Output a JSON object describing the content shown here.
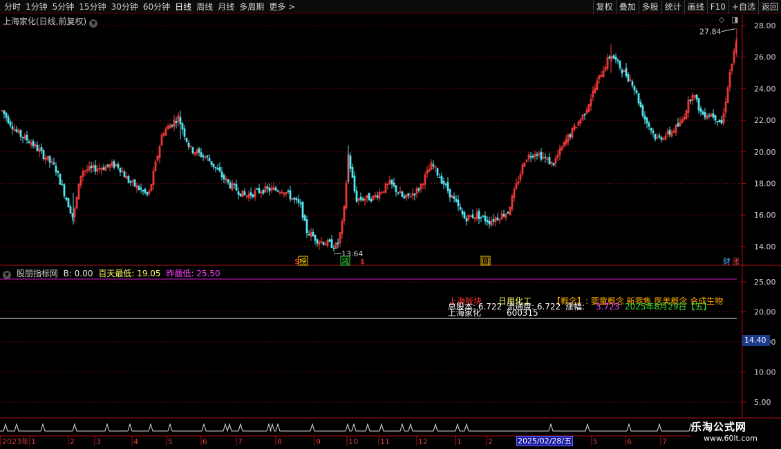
{
  "toolbar": {
    "periods": [
      "分时",
      "1分钟",
      "5分钟",
      "15分钟",
      "30分钟",
      "60分钟",
      "日线",
      "周线",
      "月线",
      "多周期",
      "更多 >"
    ],
    "active_period": "日线",
    "buttons": [
      "复权",
      "叠加",
      "多股",
      "统计",
      "画线",
      "F10",
      "+自选",
      "返回"
    ]
  },
  "main_chart": {
    "title": "上海家化(日线,前复权)",
    "y_ticks": [
      "28.00",
      "26.00",
      "24.00",
      "22.00",
      "20.00",
      "18.00",
      "16.00",
      "14.00"
    ],
    "high_label": "27.84",
    "low_label": "13.64",
    "markers": [
      {
        "text": "$",
        "color": "#ff3030"
      },
      {
        "text": "榜",
        "color": "#ffcc00"
      },
      {
        "text": "减",
        "color": "#33dd33"
      },
      {
        "text": "$",
        "color": "#ff3030"
      },
      {
        "text": "回",
        "color": "#ffcc00"
      },
      {
        "text": "财",
        "color": "#55aaff"
      },
      {
        "text": "涨",
        "color": "#ff4444"
      }
    ]
  },
  "indicator": {
    "name": "股朋指标网",
    "b_text": "B: 0.00",
    "low100_label": "百天最低:",
    "low100_value": "19.05",
    "prevlow_label": "昨最低:",
    "prevlow_value": "25.50",
    "y_ticks": [
      "25.00",
      "20.00",
      "15.00",
      "10.00",
      "5.00"
    ],
    "current_value": "14.40",
    "info": {
      "sector_label": "上海板块",
      "industry": "日用化工",
      "concept": "【概念】: 婴童概念 新零售 医美概念 合成生物",
      "total_shares": "总股本: 6.722",
      "float_shares": "流通盘: 6.722",
      "change_label": "涨幅:",
      "change_value": "3.723",
      "date": "2025年8月29日【五】",
      "stock_name": "上海家化",
      "stock_code": "600315"
    }
  },
  "date_axis": {
    "labels": [
      "2023年",
      "1",
      "2",
      "3",
      "4",
      "5",
      "6",
      "7",
      "8",
      "9",
      "10",
      "11",
      "12",
      "1",
      "2",
      "5",
      "6",
      "7"
    ],
    "selected_date": "2025/02/28/五"
  },
  "watermark": {
    "title": "乐淘公式网",
    "url": "www.60lt.com"
  },
  "colors": {
    "up": "#ff3c3c",
    "down": "#54e5f0",
    "grid": "#a01010",
    "magenta_line": "#cc22cc",
    "white_line": "#f0f0e0"
  }
}
